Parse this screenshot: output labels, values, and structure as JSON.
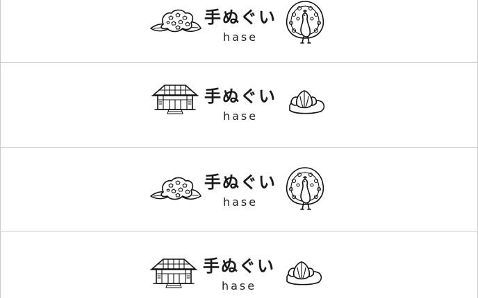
{
  "tags": [
    {
      "title": "手ぬぐい",
      "subtitle": "hase",
      "left_icon": "hydrangea-icon",
      "right_icon": "peacock-icon"
    },
    {
      "title": "手ぬぐい",
      "subtitle": "hase",
      "left_icon": "temple-icon",
      "right_icon": "lotus-icon"
    },
    {
      "title": "手ぬぐい",
      "subtitle": "hase",
      "left_icon": "hydrangea-icon",
      "right_icon": "peacock-icon"
    },
    {
      "title": "手ぬぐい",
      "subtitle": "hase",
      "left_icon": "temple-icon",
      "right_icon": "lotus-icon"
    }
  ],
  "colors": {
    "background": "#ffffff",
    "border": "#c9c9c9",
    "ink": "#1a1a1a"
  }
}
